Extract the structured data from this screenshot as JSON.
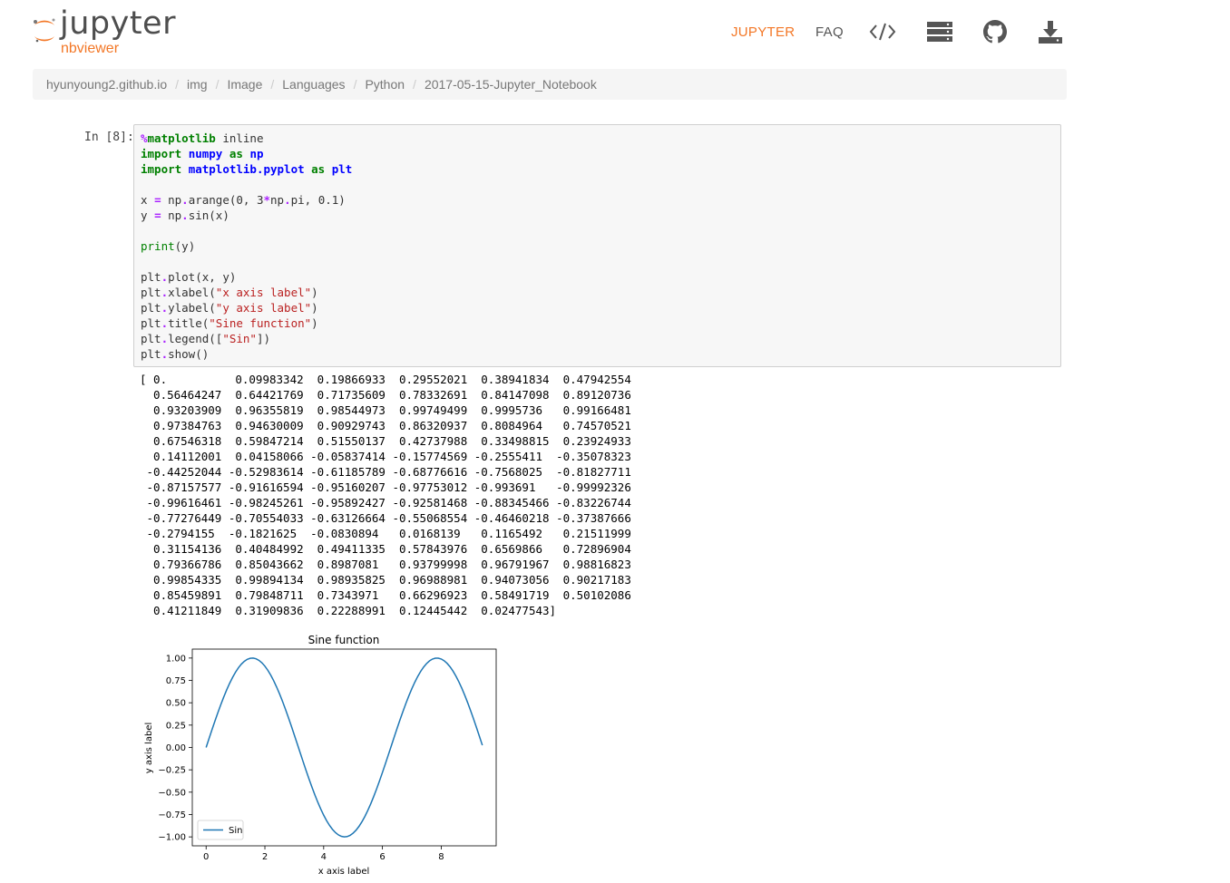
{
  "header": {
    "logo_text": "jupyter",
    "logo_sub": "nbviewer",
    "nav": {
      "jupyter": "JUPYTER",
      "faq": "FAQ",
      "icons": [
        "code-icon",
        "server-icon",
        "github-icon",
        "download-icon"
      ]
    },
    "accent_color": "#f37726"
  },
  "breadcrumb": [
    "hyunyoung2.github.io",
    "img",
    "Image",
    "Languages",
    "Python",
    "2017-05-15-Jupyter_Notebook"
  ],
  "cell": {
    "prompt": "In [8]:",
    "code_lines": [
      "%matplotlib inline",
      "import numpy as np",
      "import matplotlib.pyplot as plt",
      "",
      "x = np.arange(0, 3*np.pi, 0.1)",
      "y = np.sin(x)",
      "",
      "print(y)",
      "",
      "plt.plot(x, y)",
      "plt.xlabel(\"x axis label\")",
      "plt.ylabel(\"y axis label\")",
      "plt.title(\"Sine function\")",
      "plt.legend([\"Sin\"])",
      "plt.show()"
    ],
    "output_lines": [
      "[ 0.          0.09983342  0.19866933  0.29552021  0.38941834  0.47942554",
      "  0.56464247  0.64421769  0.71735609  0.78332691  0.84147098  0.89120736",
      "  0.93203909  0.96355819  0.98544973  0.99749499  0.9995736   0.99166481",
      "  0.97384763  0.94630009  0.90929743  0.86320937  0.8084964   0.74570521",
      "  0.67546318  0.59847214  0.51550137  0.42737988  0.33498815  0.23924933",
      "  0.14112001  0.04158066 -0.05837414 -0.15774569 -0.2555411  -0.35078323",
      " -0.44252044 -0.52983614 -0.61185789 -0.68776616 -0.7568025  -0.81827711",
      " -0.87157577 -0.91616594 -0.95160207 -0.97753012 -0.993691   -0.99992326",
      " -0.99616461 -0.98245261 -0.95892427 -0.92581468 -0.88345466 -0.83226744",
      " -0.77276449 -0.70554033 -0.63126664 -0.55068554 -0.46460218 -0.37387666",
      " -0.2794155  -0.1821625  -0.0830894   0.0168139   0.1165492   0.21511999",
      "  0.31154136  0.40484992  0.49411335  0.57843976  0.6569866   0.72896904",
      "  0.79366786  0.85043662  0.8987081   0.93799998  0.96791967  0.98816823",
      "  0.99854335  0.99894134  0.98935825  0.96988981  0.94073056  0.90217183",
      "  0.85459891  0.79848711  0.7343971   0.66296923  0.58491719  0.50102086",
      "  0.41211849  0.31909836  0.22288991  0.12445442  0.02477543]"
    ]
  },
  "chart_data": {
    "type": "line",
    "title": "Sine function",
    "xlabel": "x axis label",
    "ylabel": "y axis label",
    "xlim": [
      -0.47,
      9.87
    ],
    "ylim": [
      -1.1,
      1.1
    ],
    "xticks": [
      0,
      2,
      4,
      6,
      8
    ],
    "yticks": [
      1.0,
      0.75,
      0.5,
      0.25,
      0.0,
      -0.25,
      -0.5,
      -0.75,
      -1.0
    ],
    "ytick_labels": [
      "1.00",
      "0.75",
      "0.50",
      "0.25",
      "0.00",
      "−0.25",
      "−0.50",
      "−0.75",
      "−1.00"
    ],
    "legend": "lower-left",
    "series": [
      {
        "name": "Sin",
        "color": "#1f77b4",
        "x_start": 0,
        "x_step": 0.1,
        "values": [
          0.0,
          0.09983342,
          0.19866933,
          0.29552021,
          0.38941834,
          0.47942554,
          0.56464247,
          0.64421769,
          0.71735609,
          0.78332691,
          0.84147098,
          0.89120736,
          0.93203909,
          0.96355819,
          0.98544973,
          0.99749499,
          0.9995736,
          0.99166481,
          0.97384763,
          0.94630009,
          0.90929743,
          0.86320937,
          0.8084964,
          0.74570521,
          0.67546318,
          0.59847214,
          0.51550137,
          0.42737988,
          0.33498815,
          0.23924933,
          0.14112001,
          0.04158066,
          -0.05837414,
          -0.15774569,
          -0.2555411,
          -0.35078323,
          -0.44252044,
          -0.52983614,
          -0.61185789,
          -0.68776616,
          -0.7568025,
          -0.81827711,
          -0.87157577,
          -0.91616594,
          -0.95160207,
          -0.97753012,
          -0.993691,
          -0.99992326,
          -0.99616461,
          -0.98245261,
          -0.95892427,
          -0.92581468,
          -0.88345466,
          -0.83226744,
          -0.77276449,
          -0.70554033,
          -0.63126664,
          -0.55068554,
          -0.46460218,
          -0.37387666,
          -0.2794155,
          -0.1821625,
          -0.0830894,
          0.0168139,
          0.1165492,
          0.21511999,
          0.31154136,
          0.40484992,
          0.49411335,
          0.57843976,
          0.6569866,
          0.72896904,
          0.79366786,
          0.85043662,
          0.8987081,
          0.93799998,
          0.96791967,
          0.98816823,
          0.99854335,
          0.99894134,
          0.98935825,
          0.96988981,
          0.94073056,
          0.90217183,
          0.85459891,
          0.79848711,
          0.7343971,
          0.66296923,
          0.58491719,
          0.50102086,
          0.41211849,
          0.31909836,
          0.22288991,
          0.12445442,
          0.02477543
        ]
      }
    ]
  }
}
